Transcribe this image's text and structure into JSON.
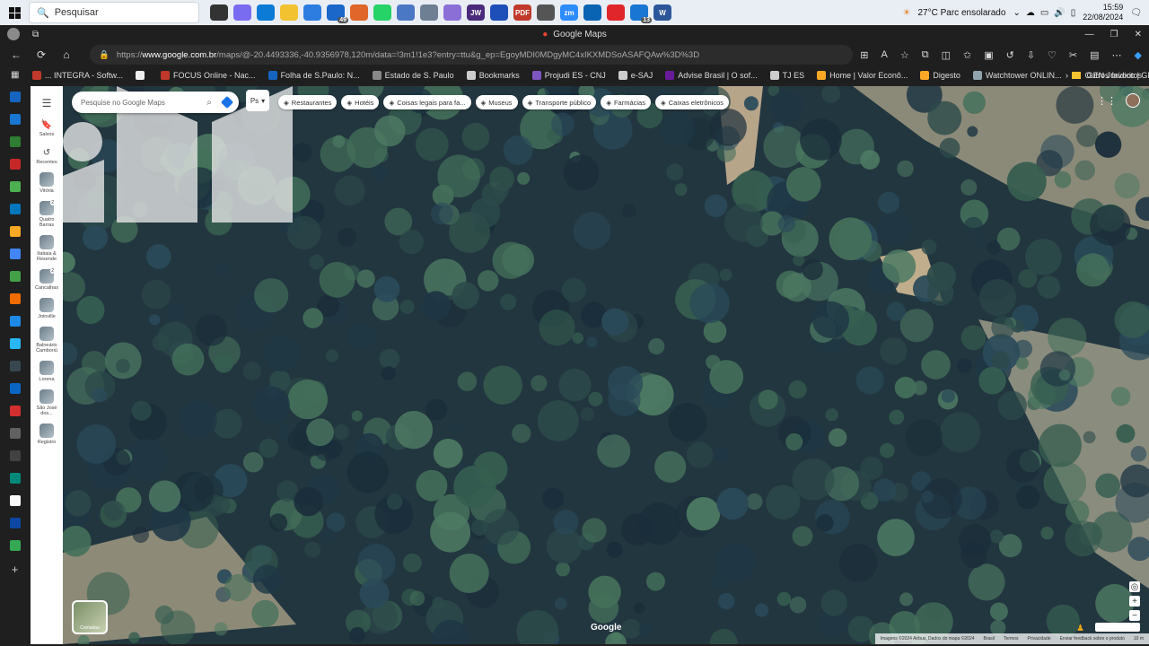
{
  "taskbar": {
    "search_placeholder": "Pesquisar",
    "apps": [
      {
        "name": "task-view",
        "color": "#333"
      },
      {
        "name": "copilot",
        "color": "#7a6cf0"
      },
      {
        "name": "edge",
        "color": "#0c7bd6"
      },
      {
        "name": "file-explorer",
        "color": "#f2c230"
      },
      {
        "name": "store",
        "color": "#2d7de0"
      },
      {
        "name": "mail",
        "color": "#1a66c9",
        "badge": "49"
      },
      {
        "name": "firefox",
        "color": "#e0662a"
      },
      {
        "name": "whatsapp",
        "color": "#25d366"
      },
      {
        "name": "calculator",
        "color": "#4b78c4"
      },
      {
        "name": "app-chart",
        "color": "#6e7f94"
      },
      {
        "name": "app-purple",
        "color": "#8b6fd6"
      },
      {
        "name": "jw",
        "color": "#4a2a7a",
        "label": "JW"
      },
      {
        "name": "calendar",
        "color": "#1e4fb8"
      },
      {
        "name": "pdf",
        "color": "#c0392b",
        "label": "PDF"
      },
      {
        "name": "clock",
        "color": "#555"
      },
      {
        "name": "zoom",
        "color": "#2d8cff",
        "label": "zm"
      },
      {
        "name": "outlook",
        "color": "#0a64b4"
      },
      {
        "name": "opera",
        "color": "#e0262b"
      },
      {
        "name": "chat",
        "color": "#1976d2",
        "badge": "13"
      },
      {
        "name": "word",
        "color": "#2b579a",
        "label": "W"
      }
    ],
    "weather": "27°C  Parc ensolarado",
    "time": "15:59",
    "date": "22/08/2024"
  },
  "browser": {
    "tab_title": "Google Maps",
    "url_prefix": "https://",
    "url_host": "www.google.com.br",
    "url_rest": "/maps/@-20.4493336,-40.9356978,120m/data=!3m1!1e3?entry=ttu&g_ep=EgoyMDI0MDgyMC4xIKXMDSoASAFQAw%3D%3D"
  },
  "bookmarks": [
    {
      "label": "... INTEGRA - Softw...",
      "color": "#c0392b"
    },
    {
      "label": "",
      "color": "#eeeeee"
    },
    {
      "label": "FOCUS Online - Nac...",
      "color": "#c0392b"
    },
    {
      "label": "Folha de S.Paulo: N...",
      "color": "#1565c0"
    },
    {
      "label": "Estado de S. Paulo",
      "color": "#888888"
    },
    {
      "label": "Bookmarks",
      "color": "#cccccc"
    },
    {
      "label": "Projudi ES - CNJ",
      "color": "#7e57c2"
    },
    {
      "label": "e-SAJ",
      "color": "#cccccc"
    },
    {
      "label": "Advise Brasil | O sof...",
      "color": "#6a1b9a"
    },
    {
      "label": "TJ ES",
      "color": "#cccccc"
    },
    {
      "label": "Home | Valor Econô...",
      "color": "#f9a825"
    },
    {
      "label": "Digesto",
      "color": "#f9a825"
    },
    {
      "label": "Watchtower ONLIN...",
      "color": "#90a4ae"
    },
    {
      "label": "GEN Jurídico | GEN ...",
      "color": "#1f1f1f"
    }
  ],
  "bookmarks_other": "Outros favoritos",
  "maps": {
    "search_placeholder": "Pesquise no Google Maps",
    "ps_label": "Ps",
    "rail": {
      "saved": "Salvos",
      "recents": "Recentes",
      "places": [
        {
          "label": "Vitória",
          "count": ""
        },
        {
          "label": "Quatro Barras",
          "count": "2"
        },
        {
          "label": "Itatiaia & Resende",
          "count": ""
        },
        {
          "label": "Cancalhas",
          "count": "2"
        },
        {
          "label": "Joinville",
          "count": ""
        },
        {
          "label": "Balneário Camboriú",
          "count": ""
        },
        {
          "label": "Lorena",
          "count": ""
        },
        {
          "label": "São José dos...",
          "count": ""
        },
        {
          "label": "Registro",
          "count": ""
        }
      ]
    },
    "chips": [
      {
        "icon": "restaurant-icon",
        "label": "Restaurantes"
      },
      {
        "icon": "hotel-icon",
        "label": "Hotéis"
      },
      {
        "icon": "camera-icon",
        "label": "Coisas legais para fa..."
      },
      {
        "icon": "museum-icon",
        "label": "Museus"
      },
      {
        "icon": "transit-icon",
        "label": "Transporte público"
      },
      {
        "icon": "pharmacy-icon",
        "label": "Farmácias"
      },
      {
        "icon": "atm-icon",
        "label": "Caixas eletrônicos"
      }
    ],
    "layers_label": "Camadas",
    "google_logo": "Google",
    "attribution": [
      "Imagens ©2024 Airbus, Dados do mapa ©2024",
      "Brasil",
      "Termos",
      "Privacidade",
      "Enviar feedback sobre o produto",
      "10 m"
    ]
  }
}
